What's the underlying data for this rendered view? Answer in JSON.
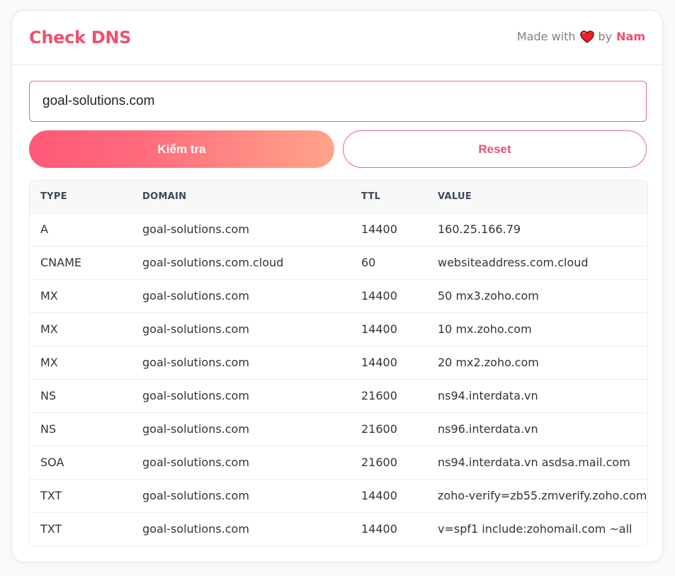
{
  "header": {
    "title": "Check DNS",
    "credit_prefix": "Made with",
    "credit_by": "by",
    "credit_author": "Nam",
    "heart_icon": "heart-icon"
  },
  "form": {
    "domain_value": "goal-solutions.com",
    "check_label": "Kiểm tra",
    "reset_label": "Reset"
  },
  "colors": {
    "accent": "#f0506e",
    "gradient_start": "#ff5878",
    "gradient_end": "#ffa489",
    "heart": "#e8202a"
  },
  "table": {
    "headers": [
      "TYPE",
      "DOMAIN",
      "TTL",
      "VALUE"
    ],
    "rows": [
      {
        "type": "A",
        "domain": "goal-solutions.com",
        "ttl": "14400",
        "value": "160.25.166.79"
      },
      {
        "type": "CNAME",
        "domain": "goal-solutions.com.cloud",
        "ttl": "60",
        "value": "websiteaddress.com.cloud"
      },
      {
        "type": "MX",
        "domain": "goal-solutions.com",
        "ttl": "14400",
        "value": "50 mx3.zoho.com"
      },
      {
        "type": "MX",
        "domain": "goal-solutions.com",
        "ttl": "14400",
        "value": "10 mx.zoho.com"
      },
      {
        "type": "MX",
        "domain": "goal-solutions.com",
        "ttl": "14400",
        "value": "20 mx2.zoho.com"
      },
      {
        "type": "NS",
        "domain": "goal-solutions.com",
        "ttl": "21600",
        "value": "ns94.interdata.vn"
      },
      {
        "type": "NS",
        "domain": "goal-solutions.com",
        "ttl": "21600",
        "value": "ns96.interdata.vn"
      },
      {
        "type": "SOA",
        "domain": "goal-solutions.com",
        "ttl": "21600",
        "value": "ns94.interdata.vn asdsa.mail.com"
      },
      {
        "type": "TXT",
        "domain": "goal-solutions.com",
        "ttl": "14400",
        "value": "zoho-verify=zb55.zmverify.zoho.com"
      },
      {
        "type": "TXT",
        "domain": "goal-solutions.com",
        "ttl": "14400",
        "value": "v=spf1 include:zohomail.com ~all"
      }
    ]
  }
}
